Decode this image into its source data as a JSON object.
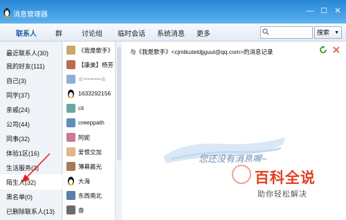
{
  "window": {
    "title": "消息管理器",
    "minimize_glyph": "—",
    "maximize_glyph": "☐",
    "close_glyph": "✕"
  },
  "tabs": [
    {
      "label": "联系人",
      "active": true
    },
    {
      "label": "群",
      "active": false
    },
    {
      "label": "讨论组",
      "active": false
    },
    {
      "label": "临时会话",
      "active": false
    },
    {
      "label": "系统消息",
      "active": false
    },
    {
      "label": "更多",
      "active": false
    }
  ],
  "search": {
    "placeholder": "",
    "button_label": "搜索",
    "arrow": "▼"
  },
  "groups": [
    {
      "label": "最近联系人(30)"
    },
    {
      "label": "我的好友(111)"
    },
    {
      "label": "自己(3)"
    },
    {
      "label": "同学(37)"
    },
    {
      "label": "亲戚(24)"
    },
    {
      "label": "公司(44)"
    },
    {
      "label": "同事(32)"
    },
    {
      "label": "体验1区(16)"
    },
    {
      "label": "生活服务(3)"
    },
    {
      "label": "陌生人(32)",
      "selected": true
    },
    {
      "label": "黑名单(0)"
    },
    {
      "label": "已删除联系人(13)"
    }
  ],
  "contacts": [
    {
      "name": "《我是歌手》",
      "avatar": "singer-avatar",
      "color": "#c9a86a"
    },
    {
      "name": "【康美】杨芳",
      "avatar": "kangmei-avatar",
      "color": "#b86e4f"
    },
    {
      "name": "☆~~~~~☆",
      "avatar": "star-avatar",
      "color": "#8bb0d6"
    },
    {
      "name": "1633292156",
      "avatar": "penguin-avatar",
      "color": "#f0b020"
    },
    {
      "name": "cii",
      "avatar": "photo-avatar",
      "color": "#6aa7a0"
    },
    {
      "name": "creeppath",
      "avatar": "photo-avatar",
      "color": "#5d8fb7"
    },
    {
      "name": "阿妮",
      "avatar": "photo-avatar",
      "color": "#c77a9a"
    },
    {
      "name": "爱恨交加",
      "avatar": "face-avatar",
      "color": "#e0b68a"
    },
    {
      "name": "薄幕晨光",
      "avatar": "face-avatar",
      "color": "#a57a5a"
    },
    {
      "name": "大海",
      "avatar": "penguin-avatar",
      "color": "#f0b020"
    },
    {
      "name": "东西南北",
      "avatar": "photo-avatar",
      "color": "#5a7fa8"
    },
    {
      "name": "奋",
      "avatar": "photo-avatar",
      "color": "#6b6b6b"
    }
  ],
  "record": {
    "title": "与《我是歌手》<cjmtkuteldjjguul@qq.com>的消息记录"
  },
  "empty_state": {
    "text": "您还没有消息喔~"
  },
  "watermark": {
    "title": "百科全说",
    "subtitle": "助你轻松解决"
  },
  "colors": {
    "titlebar": "#3d9ae2",
    "annotation_arrow": "#e02020",
    "watermark_red": "#e04020"
  }
}
